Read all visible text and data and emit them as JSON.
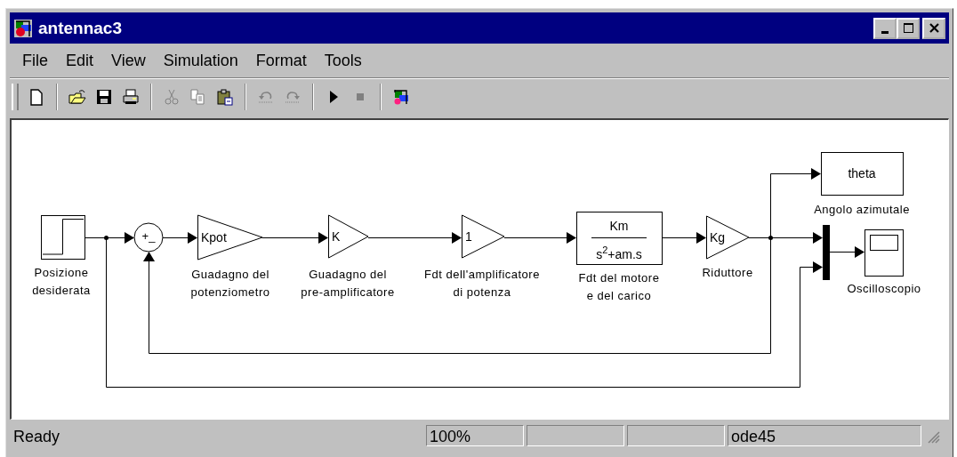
{
  "window": {
    "title": "antennac3"
  },
  "menu": [
    {
      "label": "File"
    },
    {
      "label": "Edit"
    },
    {
      "label": "View"
    },
    {
      "label": "Simulation"
    },
    {
      "label": "Format"
    },
    {
      "label": "Tools"
    }
  ],
  "toolbar": [
    {
      "kind": "new",
      "disabled": false
    },
    {
      "kind": "separator"
    },
    {
      "kind": "open",
      "disabled": false
    },
    {
      "kind": "save",
      "disabled": false
    },
    {
      "kind": "print",
      "disabled": false
    },
    {
      "kind": "separator"
    },
    {
      "kind": "cut",
      "disabled": true
    },
    {
      "kind": "copy",
      "disabled": true
    },
    {
      "kind": "paste",
      "disabled": false
    },
    {
      "kind": "separator"
    },
    {
      "kind": "undo",
      "disabled": true
    },
    {
      "kind": "redo",
      "disabled": true
    },
    {
      "kind": "separator"
    },
    {
      "kind": "start",
      "disabled": false
    },
    {
      "kind": "stop",
      "disabled": true
    },
    {
      "kind": "separator"
    },
    {
      "kind": "library",
      "disabled": false
    }
  ],
  "diagram": {
    "blocks": [
      {
        "kind": "step",
        "label": [
          "Posizione",
          "desiderata"
        ]
      },
      {
        "kind": "sum",
        "signs": "+_"
      },
      {
        "kind": "gain",
        "text": "Kpot",
        "label": [
          "Guadagno del",
          "potenziometro"
        ]
      },
      {
        "kind": "gain",
        "text": "K",
        "label": [
          "Guadagno del",
          "pre-amplificatore"
        ]
      },
      {
        "kind": "gain",
        "text": "1",
        "label": [
          "Fdt dell'amplificatore",
          "di potenza"
        ]
      },
      {
        "kind": "transfer_fcn",
        "numerator": "Km",
        "denominator": "s$^{2}$+am.s",
        "label": [
          "Fdt del motore",
          "e del carico"
        ]
      },
      {
        "kind": "gain",
        "text": "Kg",
        "label": [
          "Riduttore"
        ]
      },
      {
        "kind": "display",
        "text": "theta",
        "label": [
          "Angolo azimutale"
        ]
      },
      {
        "kind": "mux"
      },
      {
        "kind": "scope",
        "label": [
          "Oscilloscopio"
        ]
      }
    ]
  },
  "status_bar": {
    "message": "Ready",
    "zoom": "100%",
    "solver": "ode45"
  }
}
